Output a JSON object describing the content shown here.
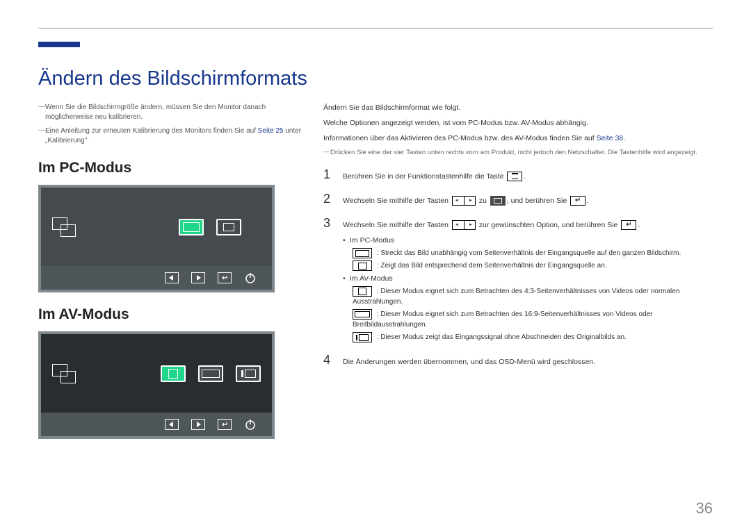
{
  "title": "Ändern des Bildschirmformats",
  "left": {
    "note1_a": "Wenn Sie die Bildschirmgröße ändern, müssen Sie den Monitor danach möglicherweise neu kalibrieren.",
    "note2_a": "Eine Anleitung zur erneuten Kalibrierung des Monitors finden Sie auf ",
    "note2_link": "Seite 25",
    "note2_b": " unter „Kalibrierung\".",
    "sec_pc": "Im PC-Modus",
    "sec_av": "Im AV-Modus"
  },
  "right": {
    "p1": "Ändern Sie das Bildschirmformat wie folgt.",
    "p2": "Welche Optionen angezeigt werden, ist vom PC-Modus bzw. AV-Modus abhängig.",
    "p3_a": "Informationen über das Aktivieren des PC-Modus bzw. des AV-Modus finden Sie auf ",
    "p3_link": "Seite 38",
    "p3_b": ".",
    "note": "Drücken Sie eine der vier Tasten unten rechts vorn am Produkt, nicht jedoch den Netzschalter. Die Tastenhilfe wird angezeigt.",
    "step1_a": "Berühren Sie in der Funktionstastenhilfe die Taste ",
    "step1_b": ".",
    "step2_a": "Wechseln Sie mithilfe der Tasten ",
    "step2_b": " zu ",
    "step2_c": ", und berühren Sie ",
    "step2_d": ".",
    "step3_a": "Wechseln Sie mithilfe der Tasten ",
    "step3_b": " zur gewünschten Option, und berühren Sie ",
    "step3_c": ".",
    "sub_pc": "Im PC-Modus",
    "d_full": " : Streckt das Bild unabhängig vom Seitenverhältnis der Eingangsquelle auf den ganzen Bildschirm.",
    "d_fit": " : Zeigt das Bild entsprechend dem Seitenverhältnis der Eingangsquelle an.",
    "sub_av": "Im AV-Modus",
    "d_43": " : Dieser Modus eignet sich zum Betrachten des 4:3-Seitenverhältnisses von Videos oder normalen Ausstrahlungen.",
    "d_169": " : Dieser Modus eignet sich zum Betrachten des 16:9-Seitenverhältnisses von Videos oder Breitbildausstrahlungen.",
    "d_dot": " : Dieser Modus zeigt das Eingangssignal ohne Abschneiden des Originalbilds an.",
    "step4": "Die Änderungen werden übernommen, und das OSD-Menü wird geschlossen."
  },
  "page_num": "36",
  "step_nums": {
    "s1": "1",
    "s2": "2",
    "s3": "3",
    "s4": "4"
  }
}
